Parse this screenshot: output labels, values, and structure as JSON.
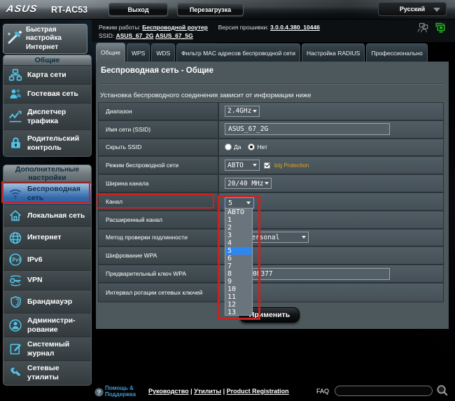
{
  "topbar": {
    "brand": "ASUS",
    "model": "RT-AC53",
    "logout_label": "Выход",
    "reboot_label": "Перезагрузка",
    "language": "Русский"
  },
  "sidebar": {
    "quick_setup": "Быстрая настройка Интернет",
    "sections": [
      {
        "title": "Общие",
        "items": [
          {
            "label": "Карта сети",
            "icon": "network-map"
          },
          {
            "label": "Гостевая сеть",
            "icon": "guest-network"
          },
          {
            "label": "Диспетчер трафика",
            "icon": "traffic-manager"
          },
          {
            "label": "Родительский контроль",
            "icon": "parental-control"
          }
        ]
      },
      {
        "title": "Дополнительные настройки",
        "items": [
          {
            "label": "Беспроводная сеть",
            "icon": "wireless",
            "selected": true
          },
          {
            "label": "Локальная сеть",
            "icon": "lan"
          },
          {
            "label": "Интернет",
            "icon": "wan"
          },
          {
            "label": "IPv6",
            "icon": "ipv6"
          },
          {
            "label": "VPN",
            "icon": "vpn"
          },
          {
            "label": "Брандмауэр",
            "icon": "firewall"
          },
          {
            "label": "Администри-рование",
            "icon": "administration"
          },
          {
            "label": "Системный журнал",
            "icon": "system-log"
          },
          {
            "label": "Сетевые утилиты",
            "icon": "network-tools"
          }
        ]
      }
    ]
  },
  "infobar": {
    "mode_label": "Режим работы:",
    "mode_value": "Беспроводной роутер",
    "fw_label": "Версия прошивки:",
    "fw_value": "3.0.0.4.380_10446",
    "ssid_label": "SSID:",
    "ssid1": "ASUS_67_2G",
    "ssid2": "ASUS_67_5G"
  },
  "tabs": [
    {
      "label": "Общие",
      "active": true
    },
    {
      "label": "WPS"
    },
    {
      "label": "WDS"
    },
    {
      "label": "Фильтр MAC адресов беспроводной сети"
    },
    {
      "label": "Настройка RADIUS"
    },
    {
      "label": "Профессионально"
    }
  ],
  "panel": {
    "title": "Беспроводная сеть - Общие",
    "description": "Установка беспроводного соединения зависит от информации ниже",
    "apply_label": "Применить",
    "rows": [
      {
        "label": "Диапазон",
        "value": "2.4GHz"
      },
      {
        "label": "Имя сети (SSID)",
        "value": "ASUS_67_2G"
      },
      {
        "label": "Скрыть SSID",
        "radio1": "Да",
        "radio2": "Нет",
        "selected": "Нет"
      },
      {
        "label": "Режим беспроводной сети",
        "value": "АВТО",
        "checkbox_label": "b/g Protection",
        "checked": true
      },
      {
        "label": "Ширина канала",
        "value": "20/40 MHz"
      },
      {
        "label": "Канал",
        "value": "5"
      },
      {
        "label": "Расширенный канал"
      },
      {
        "label": "Метод проверки подлинности",
        "value": "WPA2-Personal"
      },
      {
        "label": "Шифрование WPA"
      },
      {
        "label": "Предварительный ключ WPA",
        "value": "08377"
      },
      {
        "label": "Интервал ротации сетевых ключей"
      }
    ]
  },
  "channel_dropdown": {
    "current": "5",
    "options": [
      "АВТО",
      "1",
      "2",
      "3",
      "4",
      "5",
      "6",
      "7",
      "8",
      "9",
      "10",
      "11",
      "12",
      "13"
    ],
    "highlighted": "5"
  },
  "footer": {
    "help_line1": "Помощь &",
    "help_line2": "Поддержка",
    "link1": "Руководство",
    "link2": "Утилиты",
    "link3": "Product Registration",
    "separator": "|",
    "faq_label": "FAQ"
  }
}
